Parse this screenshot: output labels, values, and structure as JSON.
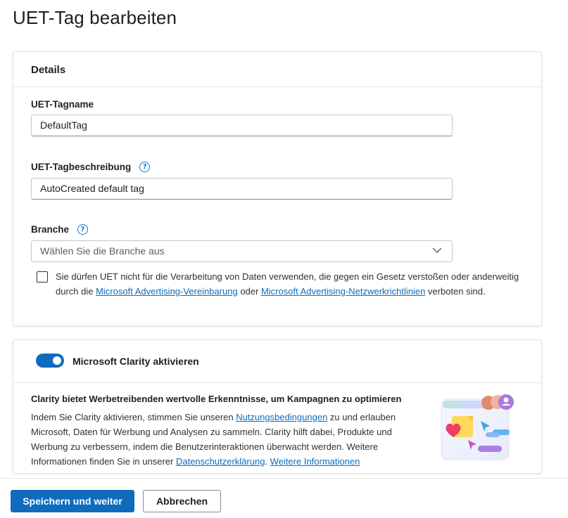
{
  "page": {
    "title": "UET-Tag bearbeiten"
  },
  "details": {
    "header": "Details",
    "name_label": "UET-Tagname",
    "name_value": "DefaultTag",
    "description_label": "UET-Tagbeschreibung",
    "description_value": "AutoCreated default tag",
    "industry_label": "Branche",
    "industry_placeholder": "Wählen Sie die Branche aus",
    "help_glyph": "?",
    "policy": {
      "text_before": "Sie dürfen UET nicht für die Verarbeitung von Daten verwenden, die gegen ein Gesetz verstoßen oder anderweitig durch die ",
      "link1": "Microsoft Advertising-Vereinbarung",
      "text_middle": " oder ",
      "link2": "Microsoft Advertising-Netzwerkrichtlinien",
      "text_after": " verboten sind."
    }
  },
  "clarity": {
    "toggle_label": "Microsoft Clarity aktivieren",
    "toggle_on": true,
    "heading": "Clarity bietet Werbetreibenden wertvolle Erkenntnisse, um Kampagnen zu optimieren",
    "body_before": "Indem Sie Clarity aktivieren, stimmen Sie unseren ",
    "terms_link": "Nutzungsbedingungen",
    "body_middle": " zu und erlauben Microsoft, Daten für Werbung und Analysen zu sammeln. Clarity hilft dabei, Produkte und Werbung zu verbessern, indem die Benutzerinteraktionen überwacht werden. Weitere Informationen finden Sie in unserer ",
    "privacy_link": "Datenschutzerklärung",
    "body_sep": ". ",
    "more_link": "Weitere Informationen"
  },
  "footer": {
    "save_label": "Speichern und weiter",
    "cancel_label": "Abbrechen"
  },
  "colors": {
    "accent": "#0f6cbd",
    "border": "#c8c6c4"
  }
}
